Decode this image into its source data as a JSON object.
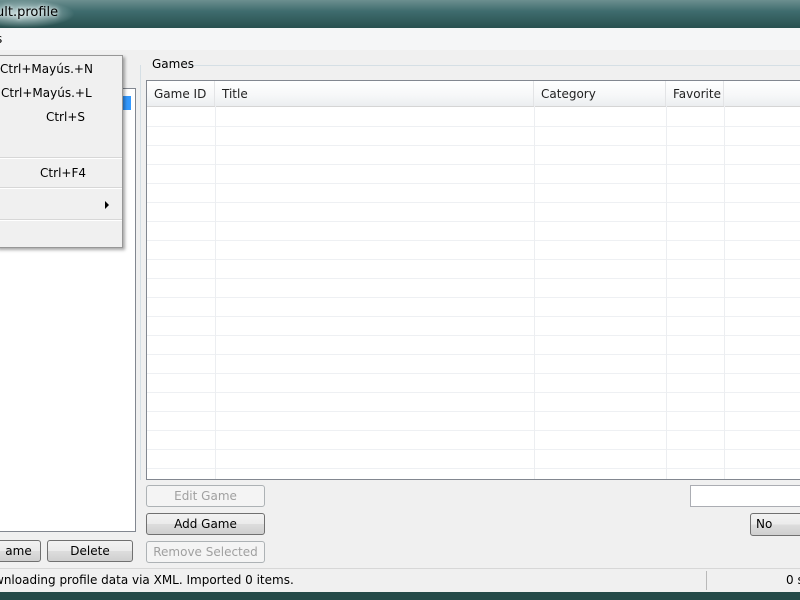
{
  "window": {
    "title": "ult.profile"
  },
  "menubar": {
    "item_label": "s"
  },
  "file_menu": {
    "items": [
      {
        "shortcut": "Ctrl+Mayús.+N"
      },
      {
        "shortcut": "Ctrl+Mayús.+L"
      },
      {
        "shortcut": "Ctrl+S"
      },
      {
        "shortcut": ""
      },
      {
        "shortcut": "Ctrl+F4"
      },
      {
        "shortcut": ""
      },
      {
        "shortcut": ""
      }
    ]
  },
  "left_panel": {
    "rename_label": "ame",
    "delete_label": "Delete"
  },
  "games": {
    "group_label": "Games",
    "columns": [
      "Game ID",
      "Title",
      "Category",
      "Favorite",
      ""
    ],
    "rows": [],
    "edit_label": "Edit Game",
    "add_label": "Add Game",
    "remove_label": "Remove Selected",
    "search_value": "",
    "favorite_filter": "No"
  },
  "status": {
    "message": "wnloading profile data via XML. Imported 0 items.",
    "right_text": "0 s"
  }
}
